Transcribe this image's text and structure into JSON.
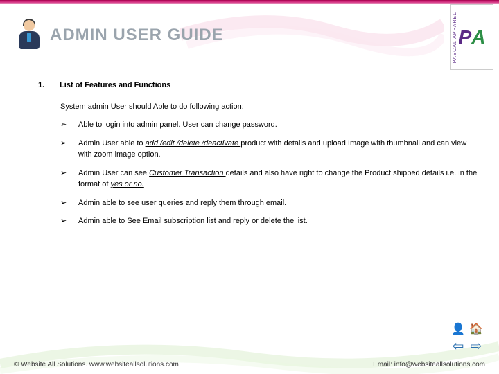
{
  "header": {
    "title": "ADMIN USER GUIDE"
  },
  "logo": {
    "brand_label": "PASCAL APPAREL",
    "letters": {
      "p": "P",
      "a": "A"
    }
  },
  "section": {
    "number": "1.",
    "heading": "List of Features and Functions",
    "intro": "System admin User should Able to do following action:",
    "items": [
      {
        "plain": "Able to login into admin panel. User can change password."
      },
      {
        "pre": "Admin User able to ",
        "ul1": "add /edit /delete /deactivate ",
        "post1": "product with details and upload Image with thumbnail and can view with zoom image option."
      },
      {
        "pre": "Admin User can see ",
        "ul1": "Customer Transaction ",
        "mid": "details and also have right to change the Product shipped details i.e. in the format of ",
        "ul2": "yes or no."
      },
      {
        "plain": "Admin able to see user queries and reply them through email."
      },
      {
        "plain": "Admin able to See Email subscription list and reply or delete the list."
      }
    ]
  },
  "footer": {
    "left": "© Website All Solutions. www.websiteallsolutions.com",
    "right": "Email: info@websiteallsolutions.com"
  }
}
